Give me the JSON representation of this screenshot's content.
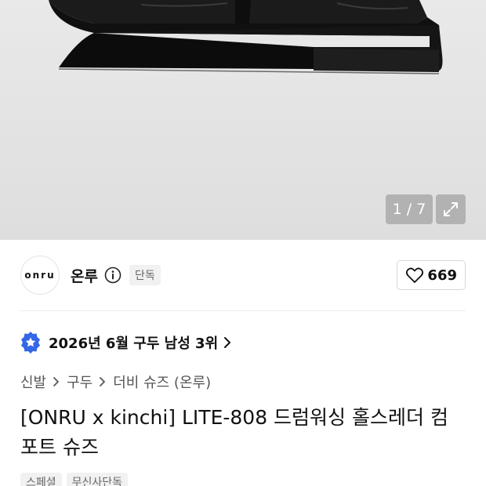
{
  "gallery": {
    "counter": "1 / 7"
  },
  "brand": {
    "logo_text": "onru",
    "name": "온루",
    "exclusive_badge": "단독"
  },
  "like": {
    "count": "669"
  },
  "ranking": {
    "text": "2026년 6월 구두 남성 3위"
  },
  "breadcrumb": {
    "items": [
      "신발",
      "구두",
      "더비 슈즈 (온루)"
    ]
  },
  "product": {
    "title": "[ONRU x kinchi] LITE-808 드럼워싱 홀스레더 컴포트 슈즈"
  },
  "tags": [
    "스페셜",
    "무신사단독"
  ],
  "colors": {
    "rank_badge": "#3467e8"
  }
}
